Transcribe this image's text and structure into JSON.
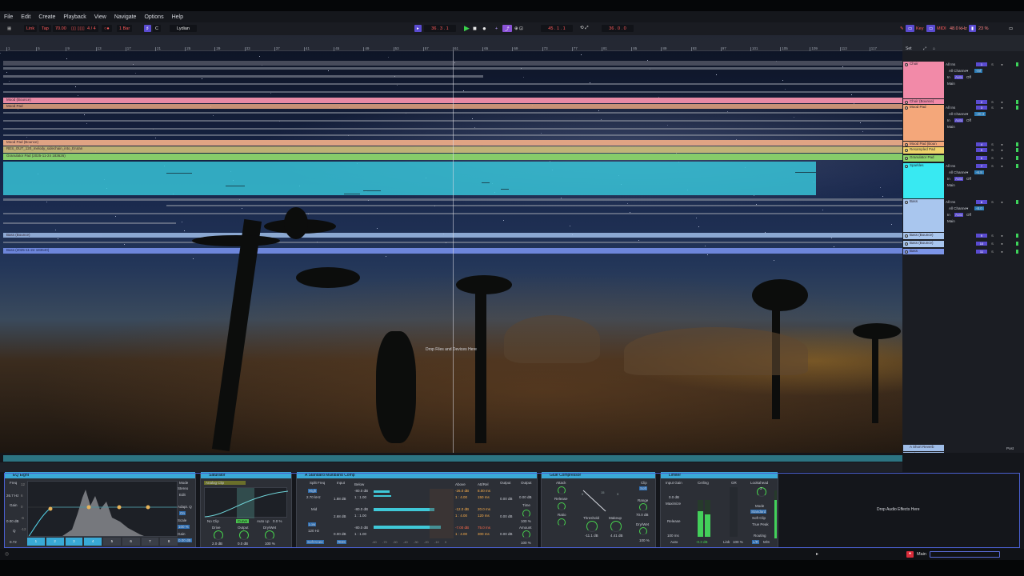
{
  "menu": [
    "File",
    "Edit",
    "Create",
    "Playback",
    "View",
    "Navigate",
    "Options",
    "Help"
  ],
  "transport": {
    "link": "Link",
    "tap": "Tap",
    "tempo": "70.00",
    "meter_mode": "▯▯ ▯▯▯",
    "signature": "4 / 4",
    "metro": "○●",
    "quant": "1 Bar",
    "key": "C",
    "scale": "Lydian",
    "position": "36 . 3 . 1",
    "loop_start": "45 . 1 . 1",
    "loop_len": "36 . 0 . 0",
    "key_map": "Key",
    "midi_map": "MIDI",
    "sample_rate": "48.0 kHz",
    "cpu": "23 %"
  },
  "ruler_numbers": [
    "1",
    "5",
    "9",
    "13",
    "17",
    "21",
    "25",
    "29",
    "33",
    "37",
    "41",
    "45",
    "49",
    "53",
    "57",
    "61",
    "65",
    "69",
    "73",
    "77",
    "81",
    "85",
    "89",
    "93",
    "97",
    "101",
    "105",
    "109",
    "113",
    "117"
  ],
  "lanes": {
    "mood_bounce": "Mood (Bounce)",
    "mood_pad": "Mood Pad",
    "mood_pad_bounce": "Mood Pad (Bounce)",
    "resampled": "RES_OUT_120_melody_sidechain_into_Erutan",
    "granulator": "Granulator Pad (2025-11-24 183626)",
    "bass_bounce": "Bass (Bounce)",
    "bass_seq": "Bass (2025-11-24 183640)"
  },
  "drop_text": "Drop Files and Devices Here",
  "mixer": {
    "set_label": "Set",
    "tracks": [
      {
        "name": "Choir",
        "color": "#f28aa8"
      },
      {
        "name": "Choir (Bounce)",
        "color": "#f28aa8"
      },
      {
        "name": "Mood Pad",
        "color": "#f4a77a"
      },
      {
        "name": "Mood Pad (Boun",
        "color": "#f4a77a"
      },
      {
        "name": "Resampled Pad",
        "color": "#efd36a"
      },
      {
        "name": "Granulator Pad",
        "color": "#8fd66c"
      },
      {
        "name": "Sparkles",
        "color": "#38e9f2"
      },
      {
        "name": "Bass",
        "color": "#a9c6ee"
      },
      {
        "name": "Bass (Bounce)",
        "color": "#a9c6ee"
      },
      {
        "name": "Bass (Bounce)",
        "color": "#a9c6ee"
      },
      {
        "name": "Bass",
        "color": "#7c95e8"
      }
    ],
    "io": {
      "in": "All Ins",
      "ch": "All Channe▾",
      "mon_in": "In",
      "mon_auto": "Auto",
      "mon_off": "Off",
      "out": "Main"
    },
    "track_numbers": [
      "1",
      "2",
      "3",
      "4",
      "5",
      "6",
      "7",
      "8",
      "9",
      "10",
      "11"
    ],
    "send_values": {
      "choir": "-inf",
      "mood": "-20.3",
      "sparkles": "-6.8",
      "bass": "-8.0"
    },
    "returns": [
      {
        "name": "A Short Reverb",
        "letter": "A"
      },
      {
        "name": "Main",
        "letter": ""
      }
    ],
    "return_post": "Post",
    "main_out": "1/2",
    "main_vol": "0",
    "cue": "1.00x"
  },
  "devices": {
    "eq": {
      "title": "EQ Eight",
      "freq_label": "Freq",
      "freq": "26.7 Hz",
      "gain_label": "Gain",
      "gain": "0.00 dB",
      "q_label": "Q",
      "q": "0.72",
      "mode_label": "Mode",
      "mode": "Stereo",
      "edit": "Edit",
      "adapt": "Adapt. Q",
      "adapt_val": "On",
      "scale_label": "Scale",
      "scale": "100 %",
      "out_label": "Gain",
      "out": "0.00 dB",
      "axis": [
        "12",
        "6",
        "0",
        "-6",
        "-12"
      ],
      "bands": [
        "1",
        "2",
        "3",
        "4",
        "5",
        "6",
        "7",
        "8"
      ]
    },
    "sat": {
      "title": "Saturator",
      "type": "Analog Clip",
      "clip": "No Clip",
      "curve": "Curve",
      "auto": "Auto Lp",
      "auto_val": "0.0 %",
      "drive_label": "Drive",
      "drive": "2.0 dB",
      "output_label": "Output",
      "output": "0.0 dB",
      "drywet_label": "Dry/Wet",
      "drywet": "100 %"
    },
    "mb": {
      "title": "A Standard Multiband Comp",
      "split": "Split Freq",
      "input": "Input",
      "below": "Below",
      "above": "Above",
      "attrel": "Att/Rel",
      "output": "Output",
      "high": "High",
      "high_f": "2.70 kHz",
      "mid": "Mid",
      "low": "Low",
      "low_f": "120 Hz",
      "soft": "Soft Knee",
      "rms": "RMS",
      "in_vals": [
        "1.88 dB",
        "2.68 dB",
        "0.00 dB"
      ],
      "below_vals": [
        "-80.0 dB",
        "1 : 1.00",
        "-80.0 dB",
        "1 : 1.00",
        "-80.0 dB",
        "1 : 1.00"
      ],
      "above_vals": [
        "-26.0 dB",
        "1 : 4.00",
        "-12.0 dB",
        "1 : 4.00",
        "-7.00 dB",
        "1 : 4.00"
      ],
      "att_vals": [
        "8.00 ms",
        "150 ms",
        "20.0 ms",
        "120 ms",
        "75.0 ms",
        "300 ms"
      ],
      "out_vals": [
        "0.00 dB",
        "0.00 dB",
        "0.00 dB"
      ],
      "out2": "0.00 dB",
      "time": "Time",
      "time_val": "100 %",
      "amount": "Amount",
      "amount_val": "100 %",
      "axis": [
        "-60",
        "-70",
        "-50",
        "-40",
        "-30",
        "-20",
        "-10",
        "0"
      ]
    },
    "glue": {
      "title": "Glue Compressor",
      "attack": "Attack",
      "release": "Release",
      "ratio": "Ratio",
      "threshold": "Threshold",
      "threshold_val": "-11.1 dB",
      "makeup": "Makeup",
      "makeup_val": "4.41 dB",
      "clip": "Clip",
      "soft": "Soft",
      "range": "Range",
      "range_val": "70.0 dB",
      "drywet": "Dry/Wet",
      "drywet_val": "100 %",
      "scale": [
        "0",
        "15",
        "3",
        "6",
        "9"
      ]
    },
    "lim": {
      "title": "Limiter",
      "input_gain": "Input Gain",
      "input_val": "0.0 dB",
      "maximize": "Maximize",
      "ceiling": "Ceiling",
      "gr": "GR",
      "release": "Release",
      "release_val": "100 ms",
      "auto": "Auto",
      "lookahead": "Lookahead",
      "la_val": "3",
      "mode_label": "Mode",
      "mode": "Standard",
      "soft": "Soft Clip",
      "true_peak": "True Peak",
      "routing": "Routing",
      "lr": "L/R",
      "ms": "M/S",
      "link": "Link",
      "link_val": "100 %",
      "ceil_val": "-0.3 dB"
    },
    "drop": "Drop Audio Effects Here"
  },
  "status": {
    "main": "Main"
  }
}
